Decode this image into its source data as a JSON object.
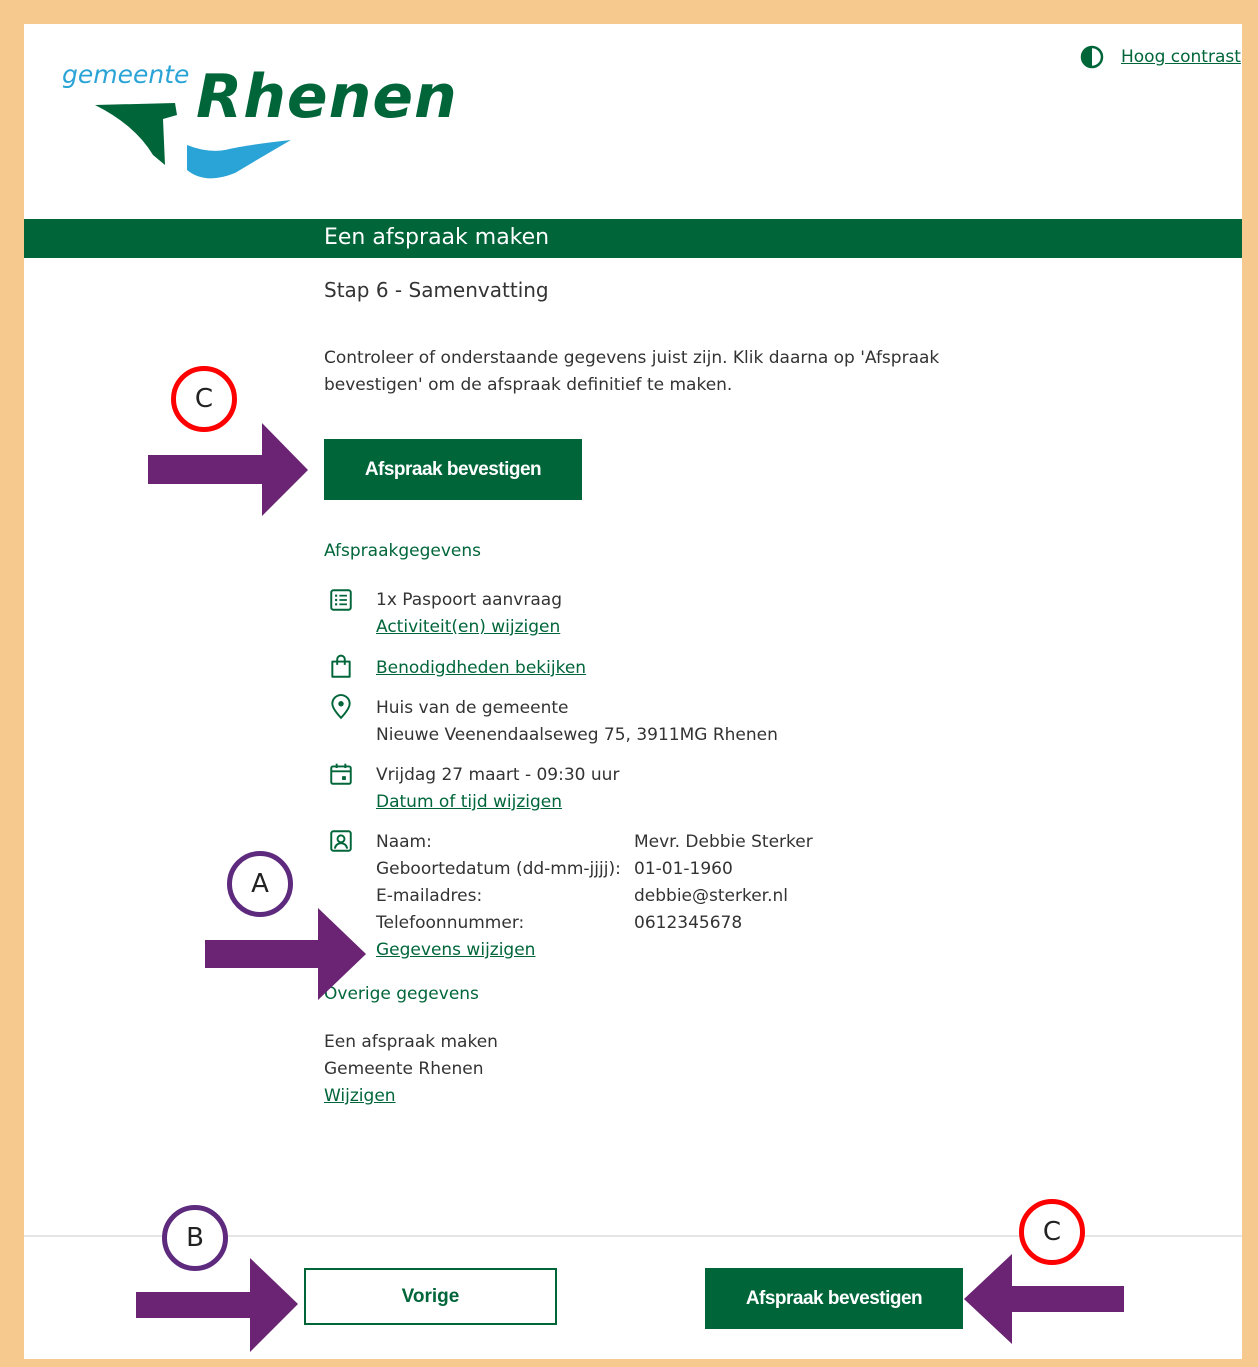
{
  "header": {
    "logo_small": "gemeente",
    "logo_large": "Rhenen",
    "contrast_link": "Hoog contrast"
  },
  "banner": {
    "title": "Een afspraak maken"
  },
  "step": "Stap 6 - Samenvatting",
  "intro": "Controleer of onderstaande gegevens juist zijn. Klik daarna op 'Afspraak bevestigen' om de afspraak definitief te maken.",
  "confirm_button": "Afspraak bevestigen",
  "appointment": {
    "heading": "Afspraakgegevens",
    "activity": "1x Paspoort aanvraag",
    "activity_link": "Activiteit(en) wijzigen",
    "requirements_link": "Benodigdheden bekijken",
    "location_name": "Huis van de gemeente",
    "location_address": "Nieuwe Veenendaalseweg 75, 3911MG Rhenen",
    "datetime": "Vrijdag 27 maart - 09:30 uur",
    "datetime_link": "Datum of tijd wijzigen"
  },
  "personal": {
    "rows": [
      {
        "label": "Naam:",
        "value": "Mevr. Debbie Sterker"
      },
      {
        "label": "Geboortedatum (dd-mm-jjjj):",
        "value": "01-01-1960"
      },
      {
        "label": "E-mailadres:",
        "value": "debbie@sterker.nl"
      },
      {
        "label": "Telefoonnummer:",
        "value": "0612345678"
      }
    ],
    "edit_link": "Gegevens wijzigen"
  },
  "other": {
    "heading": "Overige gegevens",
    "line1": "Een afspraak maken",
    "line2": "Gemeente Rhenen",
    "edit_link": "Wijzigen"
  },
  "footer": {
    "prev_button": "Vorige",
    "confirm_button": "Afspraak bevestigen"
  },
  "annotations": {
    "label_a": "A",
    "label_b": "B",
    "label_c": "C",
    "arrow_color": "#6b2373",
    "red_circle_color": "#ff0000",
    "purple_circle_color": "#5e2a7e"
  },
  "colors": {
    "brand_green": "#00663a",
    "logo_blue": "#2aa3d6",
    "border": "#f6c98f"
  }
}
